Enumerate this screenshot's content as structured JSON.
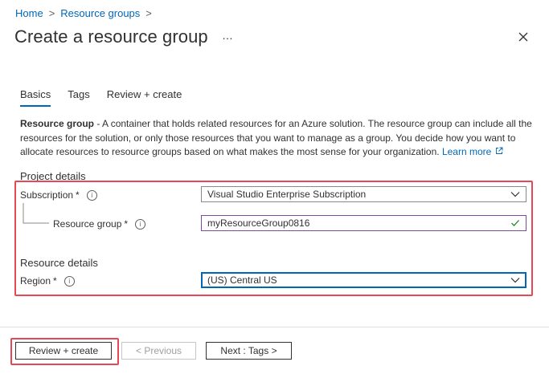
{
  "breadcrumb": {
    "home": "Home",
    "resource_groups": "Resource groups",
    "sep": ">"
  },
  "header": {
    "title": "Create a resource group",
    "more": "…",
    "close_icon": "close-icon"
  },
  "tabs": [
    {
      "label": "Basics",
      "active": true
    },
    {
      "label": "Tags",
      "active": false
    },
    {
      "label": "Review + create",
      "active": false
    }
  ],
  "description": {
    "bold": "Resource group",
    "text": " - A container that holds related resources for an Azure solution. The resource group can include all the resources for the solution, or only those resources that you want to manage as a group. You decide how you want to allocate resources to resource groups based on what makes the most sense for your organization. ",
    "learn_more": "Learn more"
  },
  "project_details": {
    "heading": "Project details",
    "subscription": {
      "label": "Subscription",
      "required": "*",
      "value": "Visual Studio Enterprise Subscription"
    },
    "resource_group": {
      "label": "Resource group",
      "required": "*",
      "value": "myResourceGroup0816"
    }
  },
  "resource_details": {
    "heading": "Resource details",
    "region": {
      "label": "Region",
      "required": "*",
      "value": "(US) Central US"
    }
  },
  "footer": {
    "review_create": "Review + create",
    "previous": "< Previous",
    "next": "Next : Tags >"
  },
  "colors": {
    "link": "#0067b8",
    "highlight": "#e74856",
    "valid": "#107c10"
  }
}
